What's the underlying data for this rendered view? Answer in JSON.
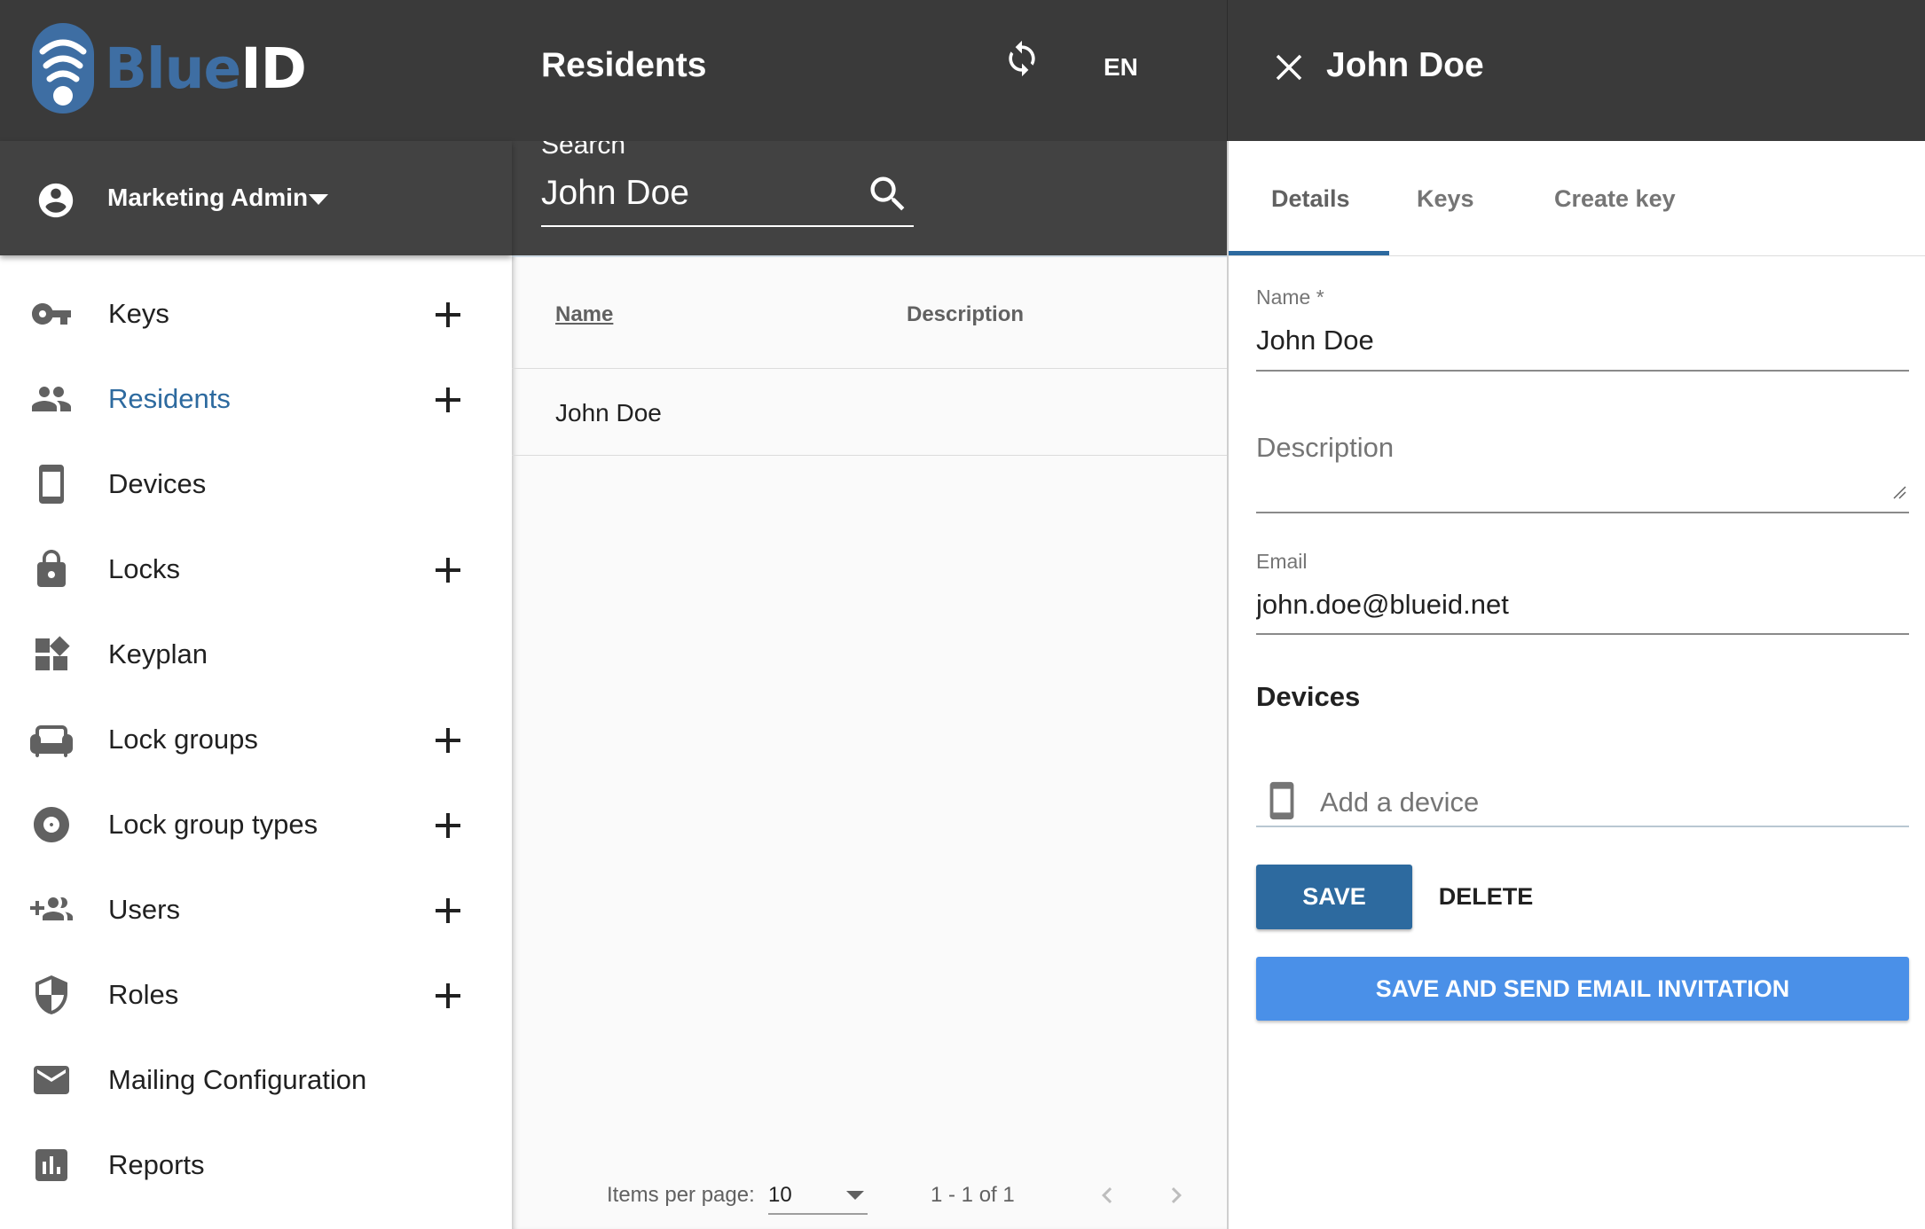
{
  "brand": {
    "logo_blue": "Blue",
    "logo_white": "ID",
    "color": "#3e6ea3"
  },
  "user": {
    "name": "Marketing Admin",
    "icon": "account-circle-icon"
  },
  "sidebar": {
    "items": [
      {
        "label": "Keys",
        "icon": "key-icon",
        "has_add": true,
        "active": false
      },
      {
        "label": "Residents",
        "icon": "people-icon",
        "has_add": true,
        "active": true
      },
      {
        "label": "Devices",
        "icon": "smartphone-icon",
        "has_add": false,
        "active": false
      },
      {
        "label": "Locks",
        "icon": "lock-icon",
        "has_add": true,
        "active": false
      },
      {
        "label": "Keyplan",
        "icon": "widgets-icon",
        "has_add": false,
        "active": false
      },
      {
        "label": "Lock groups",
        "icon": "sofa-icon",
        "has_add": true,
        "active": false
      },
      {
        "label": "Lock group types",
        "icon": "disc-icon",
        "has_add": true,
        "active": false
      },
      {
        "label": "Users",
        "icon": "group-add-icon",
        "has_add": true,
        "active": false
      },
      {
        "label": "Roles",
        "icon": "shield-icon",
        "has_add": true,
        "active": false
      },
      {
        "label": "Mailing Configuration",
        "icon": "mail-icon",
        "has_add": false,
        "active": false
      },
      {
        "label": "Reports",
        "icon": "bar-chart-icon",
        "has_add": false,
        "active": false
      }
    ]
  },
  "header": {
    "title": "Residents",
    "language": "EN"
  },
  "search": {
    "label": "Search",
    "value": "John Doe"
  },
  "table": {
    "columns": [
      "Name",
      "Description"
    ],
    "rows": [
      {
        "name": "John Doe",
        "description": ""
      }
    ]
  },
  "paginator": {
    "items_per_page_label": "Items per page:",
    "page_size": "10",
    "range": "1 - 1 of 1"
  },
  "detail": {
    "title": "John Doe",
    "tabs": [
      "Details",
      "Keys",
      "Create key"
    ],
    "active_tab": "Details",
    "name_label": "Name *",
    "name_value": "John Doe",
    "description_placeholder": "Description",
    "description_value": "",
    "email_label": "Email",
    "email_value": "john.doe@blueid.net",
    "devices_heading": "Devices",
    "add_device_placeholder": "Add a device",
    "save_label": "SAVE",
    "delete_label": "DELETE",
    "save_invite_label": "SAVE AND SEND EMAIL INVITATION"
  },
  "colors": {
    "header_bg": "#3a3a3a",
    "subheader_bg": "#424242",
    "accent": "#2d6a9f",
    "invite_button": "#4a90e8"
  }
}
